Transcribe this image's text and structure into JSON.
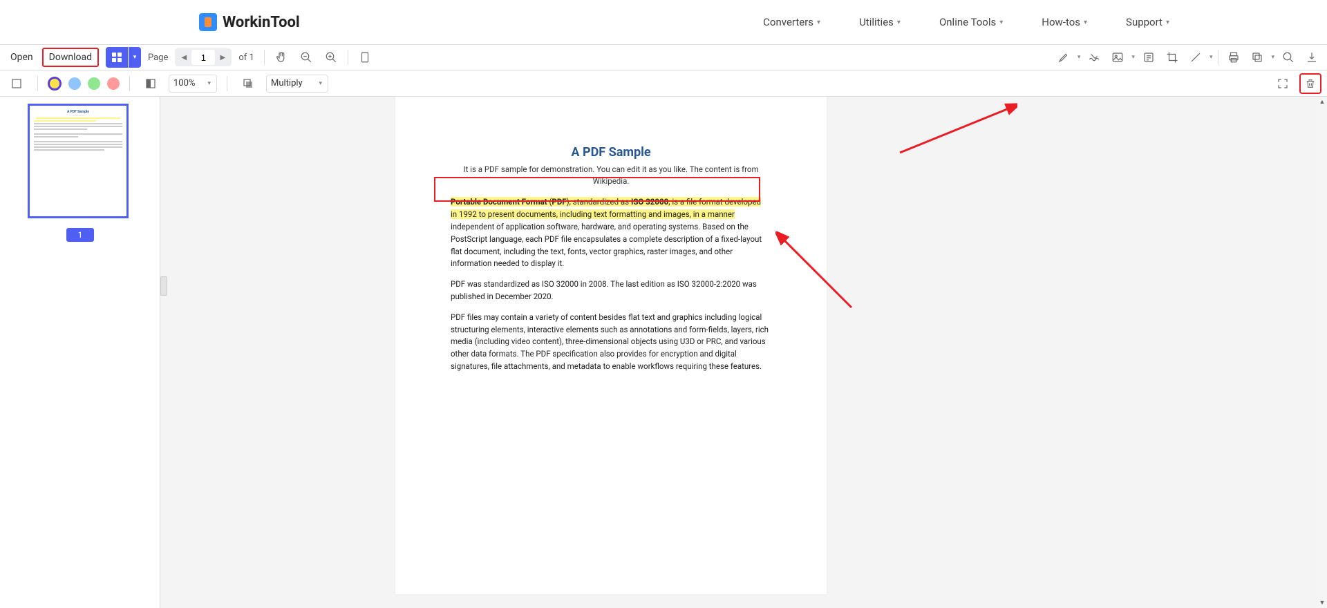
{
  "brand": {
    "name": "WorkinTool"
  },
  "nav": {
    "items": [
      "Converters",
      "Utilities",
      "Online Tools",
      "How-tos",
      "Support"
    ]
  },
  "toolbar": {
    "open": "Open",
    "download": "Download",
    "page_label": "Page",
    "page_current": "1",
    "of_label": "of 1",
    "icons": {
      "hand": "hand-icon",
      "zoom_out": "zoom-out-icon",
      "zoom_in": "zoom-in-icon",
      "fit_page": "fit-page-icon",
      "highlight": "highlight-icon",
      "squiggly": "squiggly-icon",
      "image": "image-icon",
      "note": "note-icon",
      "crop": "crop-icon",
      "line": "line-icon",
      "print": "print-icon",
      "copy": "copy-icon",
      "search": "search-icon",
      "download": "download-icon"
    }
  },
  "toolbar2": {
    "zoom_value": "100%",
    "blend_value": "Multiply",
    "icons": {
      "select_rect": "select-rect-icon",
      "opacity": "opacity-icon",
      "overlay": "overlay-icon",
      "fullscreen": "fullscreen-icon",
      "trash": "trash-icon"
    },
    "colors": [
      "yellow-ring",
      "blue",
      "green",
      "red"
    ]
  },
  "sidebar": {
    "page_number": "1"
  },
  "document": {
    "title": "A PDF Sample",
    "subtitle": "It is a PDF sample for demonstration. You can edit it as you like. The content is from Wikipedia.",
    "para1_hl_b1": "Portable Document Format",
    "para1_hl_mid1": " (",
    "para1_hl_b2": "PDF",
    "para1_hl_mid2": "), standardized as ",
    "para1_hl_b3": "ISO 32000",
    "para1_hl_tail1": ", is a file format developed",
    "para1_hl_line2": "in 1992 to present documents, including text formatting and images, in a manner",
    "para1_plain": " independent of application software, hardware, and operating systems. Based on the PostScript language, each PDF file encapsulates a complete description of a fixed-layout flat document, including the text, fonts, vector graphics, raster images, and other information needed to display it.",
    "para2": "PDF was standardized as ISO 32000 in 2008. The last edition as ISO 32000-2:2020 was published in December 2020.",
    "para3": "PDF files may contain a variety of content besides flat text and graphics including logical structuring elements, interactive elements such as annotations and form-fields, layers, rich media (including video content), three-dimensional objects using U3D or PRC, and various other data formats. The PDF specification also provides for encryption and digital signatures, file attachments, and metadata to enable workflows requiring these features."
  }
}
